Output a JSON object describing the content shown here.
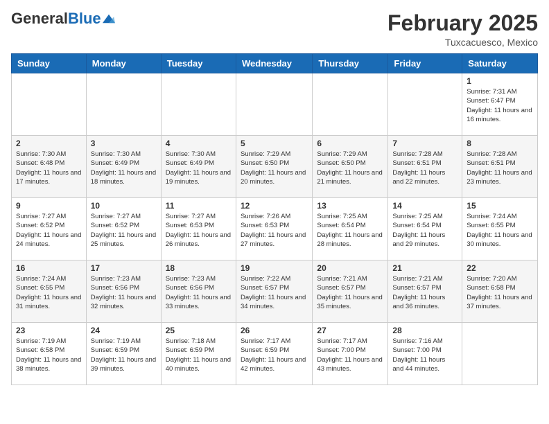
{
  "header": {
    "logo": {
      "general": "General",
      "blue": "Blue"
    },
    "title": "February 2025",
    "location": "Tuxcacuesco, Mexico"
  },
  "days_of_week": [
    "Sunday",
    "Monday",
    "Tuesday",
    "Wednesday",
    "Thursday",
    "Friday",
    "Saturday"
  ],
  "weeks": [
    {
      "days": [
        {
          "num": "",
          "info": ""
        },
        {
          "num": "",
          "info": ""
        },
        {
          "num": "",
          "info": ""
        },
        {
          "num": "",
          "info": ""
        },
        {
          "num": "",
          "info": ""
        },
        {
          "num": "",
          "info": ""
        },
        {
          "num": "1",
          "info": "Sunrise: 7:31 AM\nSunset: 6:47 PM\nDaylight: 11 hours and 16 minutes."
        }
      ]
    },
    {
      "days": [
        {
          "num": "2",
          "info": "Sunrise: 7:30 AM\nSunset: 6:48 PM\nDaylight: 11 hours and 17 minutes."
        },
        {
          "num": "3",
          "info": "Sunrise: 7:30 AM\nSunset: 6:49 PM\nDaylight: 11 hours and 18 minutes."
        },
        {
          "num": "4",
          "info": "Sunrise: 7:30 AM\nSunset: 6:49 PM\nDaylight: 11 hours and 19 minutes."
        },
        {
          "num": "5",
          "info": "Sunrise: 7:29 AM\nSunset: 6:50 PM\nDaylight: 11 hours and 20 minutes."
        },
        {
          "num": "6",
          "info": "Sunrise: 7:29 AM\nSunset: 6:50 PM\nDaylight: 11 hours and 21 minutes."
        },
        {
          "num": "7",
          "info": "Sunrise: 7:28 AM\nSunset: 6:51 PM\nDaylight: 11 hours and 22 minutes."
        },
        {
          "num": "8",
          "info": "Sunrise: 7:28 AM\nSunset: 6:51 PM\nDaylight: 11 hours and 23 minutes."
        }
      ]
    },
    {
      "days": [
        {
          "num": "9",
          "info": "Sunrise: 7:27 AM\nSunset: 6:52 PM\nDaylight: 11 hours and 24 minutes."
        },
        {
          "num": "10",
          "info": "Sunrise: 7:27 AM\nSunset: 6:52 PM\nDaylight: 11 hours and 25 minutes."
        },
        {
          "num": "11",
          "info": "Sunrise: 7:27 AM\nSunset: 6:53 PM\nDaylight: 11 hours and 26 minutes."
        },
        {
          "num": "12",
          "info": "Sunrise: 7:26 AM\nSunset: 6:53 PM\nDaylight: 11 hours and 27 minutes."
        },
        {
          "num": "13",
          "info": "Sunrise: 7:25 AM\nSunset: 6:54 PM\nDaylight: 11 hours and 28 minutes."
        },
        {
          "num": "14",
          "info": "Sunrise: 7:25 AM\nSunset: 6:54 PM\nDaylight: 11 hours and 29 minutes."
        },
        {
          "num": "15",
          "info": "Sunrise: 7:24 AM\nSunset: 6:55 PM\nDaylight: 11 hours and 30 minutes."
        }
      ]
    },
    {
      "days": [
        {
          "num": "16",
          "info": "Sunrise: 7:24 AM\nSunset: 6:55 PM\nDaylight: 11 hours and 31 minutes."
        },
        {
          "num": "17",
          "info": "Sunrise: 7:23 AM\nSunset: 6:56 PM\nDaylight: 11 hours and 32 minutes."
        },
        {
          "num": "18",
          "info": "Sunrise: 7:23 AM\nSunset: 6:56 PM\nDaylight: 11 hours and 33 minutes."
        },
        {
          "num": "19",
          "info": "Sunrise: 7:22 AM\nSunset: 6:57 PM\nDaylight: 11 hours and 34 minutes."
        },
        {
          "num": "20",
          "info": "Sunrise: 7:21 AM\nSunset: 6:57 PM\nDaylight: 11 hours and 35 minutes."
        },
        {
          "num": "21",
          "info": "Sunrise: 7:21 AM\nSunset: 6:57 PM\nDaylight: 11 hours and 36 minutes."
        },
        {
          "num": "22",
          "info": "Sunrise: 7:20 AM\nSunset: 6:58 PM\nDaylight: 11 hours and 37 minutes."
        }
      ]
    },
    {
      "days": [
        {
          "num": "23",
          "info": "Sunrise: 7:19 AM\nSunset: 6:58 PM\nDaylight: 11 hours and 38 minutes."
        },
        {
          "num": "24",
          "info": "Sunrise: 7:19 AM\nSunset: 6:59 PM\nDaylight: 11 hours and 39 minutes."
        },
        {
          "num": "25",
          "info": "Sunrise: 7:18 AM\nSunset: 6:59 PM\nDaylight: 11 hours and 40 minutes."
        },
        {
          "num": "26",
          "info": "Sunrise: 7:17 AM\nSunset: 6:59 PM\nDaylight: 11 hours and 42 minutes."
        },
        {
          "num": "27",
          "info": "Sunrise: 7:17 AM\nSunset: 7:00 PM\nDaylight: 11 hours and 43 minutes."
        },
        {
          "num": "28",
          "info": "Sunrise: 7:16 AM\nSunset: 7:00 PM\nDaylight: 11 hours and 44 minutes."
        },
        {
          "num": "",
          "info": ""
        }
      ]
    }
  ]
}
